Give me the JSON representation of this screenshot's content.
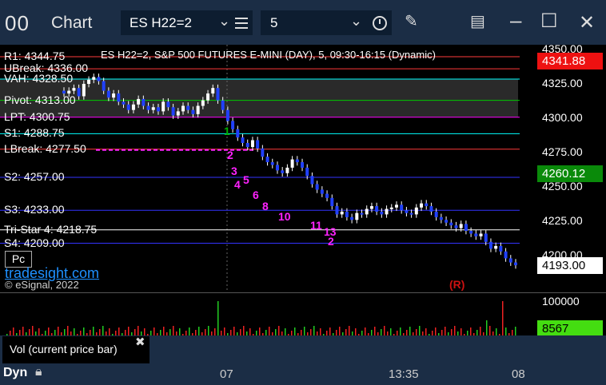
{
  "app": {
    "icon": "chart-window-icon",
    "icon_text": "00",
    "title": "Chart"
  },
  "toolbar": {
    "symbol": "ES H22=2",
    "interval": "5",
    "icons": [
      "chevron-down-icon",
      "menu-icon",
      "chevron-down-icon",
      "clock-icon",
      "pencil-icon",
      "page-settings-icon",
      "minimize-icon",
      "maximize-icon",
      "close-icon"
    ]
  },
  "chart": {
    "description": "ES H22=2, S&P 500 FUTURES E-MINI (DAY), 5, 09:30-16:15 (Dynamic)",
    "levels": [
      {
        "label": "R1: 4344.75",
        "price": 4344.75,
        "color": "#ff3b3b"
      },
      {
        "label": "UBreak: 4336.00",
        "price": 4336.0,
        "color": "#ff3b3b"
      },
      {
        "label": "VAH: 4328.50",
        "price": 4328.5,
        "color": "#00ffff"
      },
      {
        "label": "Pivot: 4313.00",
        "price": 4313.0,
        "color": "#00c800"
      },
      {
        "label": "LPT: 4300.75",
        "price": 4300.75,
        "color": "#ff00ff"
      },
      {
        "label": "S1: 4288.75",
        "price": 4288.75,
        "color": "#00ffff"
      },
      {
        "label": "LBreak: 4277.50",
        "price": 4277.5,
        "color": "#ff3b3b"
      },
      {
        "label": "S2: 4257.00",
        "price": 4257.0,
        "color": "#3333ff"
      },
      {
        "label": "S3: 4233.00",
        "price": 4233.0,
        "color": "#3333ff"
      },
      {
        "label": "Tri-Star 4: 4218.75",
        "price": 4218.75,
        "color": "#ffffff"
      },
      {
        "label": "S4: 4209.00",
        "price": 4209.0,
        "color": "#3333ff"
      }
    ],
    "price_ticks": [
      "4350.00",
      "4325.00",
      "4300.00",
      "4275.00",
      "4250.00",
      "4225.00",
      "4200.00"
    ],
    "price_badges": [
      {
        "text": "4341.88",
        "bg": "#ee1111",
        "fg": "#ffffff"
      },
      {
        "text": "4260.12",
        "bg": "#0a8a0a",
        "fg": "#ffffff"
      },
      {
        "text": "4193.00",
        "bg": "#ffffff",
        "fg": "#000000"
      }
    ],
    "markers": [
      {
        "text": "1",
        "color": "#00b000"
      },
      {
        "text": "2",
        "color": "#ff22ff"
      },
      {
        "text": "3",
        "color": "#ff22ff"
      },
      {
        "text": "4",
        "color": "#ff22ff"
      },
      {
        "text": "5",
        "color": "#ff22ff"
      },
      {
        "text": "6",
        "color": "#ff22ff"
      },
      {
        "text": "8",
        "color": "#ff22ff"
      },
      {
        "text": "10",
        "color": "#ff22ff"
      },
      {
        "text": "11",
        "color": "#ff22ff"
      },
      {
        "text": "13",
        "color": "#ff22ff"
      },
      {
        "text": "(R)",
        "color": "#cc1111"
      }
    ],
    "pc_button": "Pc",
    "watermark": "tradesight.com",
    "copyright": "© eSignal, 2022"
  },
  "volume": {
    "ticks": [
      "100000"
    ],
    "badge": {
      "text": "8567",
      "bg": "#44dd11",
      "fg": "#000000"
    },
    "legend": "Vol (current price bar)",
    "close": "✖"
  },
  "time_axis": {
    "labels": [
      "07",
      "13:35",
      "08"
    ]
  },
  "status": {
    "mode": "Dyn",
    "lock_icon": "lock-icon"
  },
  "chart_data": {
    "type": "candlestick",
    "title": "ES H22=2, S&P 500 FUTURES E-MINI (DAY), 5, 09:30-16:15 (Dynamic)",
    "ylim": [
      4185,
      4355
    ],
    "close": [
      4318,
      4320,
      4322,
      4316,
      4325,
      4328,
      4330,
      4327,
      4320,
      4315,
      4318,
      4312,
      4310,
      4306,
      4310,
      4314,
      4309,
      4306,
      4308,
      4305,
      4312,
      4308,
      4302,
      4305,
      4309,
      4306,
      4303,
      4309,
      4313,
      4318,
      4322,
      4313,
      4306,
      4298,
      4292,
      4286,
      4282,
      4279,
      4284,
      4278,
      4272,
      4268,
      4266,
      4262,
      4260,
      4264,
      4270,
      4268,
      4264,
      4258,
      4252,
      4248,
      4245,
      4242,
      4236,
      4230,
      4232,
      4228,
      4226,
      4231,
      4230,
      4234,
      4236,
      4232,
      4230,
      4234,
      4235,
      4237,
      4233,
      4231,
      4230,
      4235,
      4238,
      4236,
      4232,
      4228,
      4226,
      4224,
      4222,
      4220,
      4223,
      4218,
      4216,
      4214,
      4216,
      4210,
      4205,
      4207,
      4203,
      4198,
      4195,
      4193
    ]
  }
}
